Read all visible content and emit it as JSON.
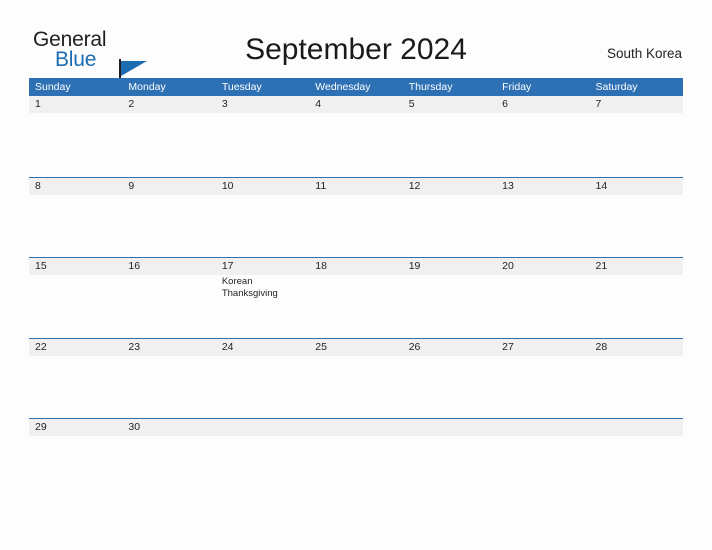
{
  "branding": {
    "logo_text_top": "General",
    "logo_text_bottom": "Blue",
    "logo_color_dark": "#231f20",
    "logo_color_blue": "#1b6cb0"
  },
  "header": {
    "title": "September 2024",
    "region": "South Korea"
  },
  "colors": {
    "header_blue": "#2d71b4",
    "band_gray": "#f0f0f0",
    "row_rule_blue": "#2d71b4",
    "page_background": "#fdfdfd",
    "text": "#231f20"
  },
  "calendar": {
    "month": "September",
    "year": "2024",
    "day_names": [
      "Sunday",
      "Monday",
      "Tuesday",
      "Wednesday",
      "Thursday",
      "Friday",
      "Saturday"
    ],
    "weeks": [
      [
        {
          "date": "1",
          "events": []
        },
        {
          "date": "2",
          "events": []
        },
        {
          "date": "3",
          "events": []
        },
        {
          "date": "4",
          "events": []
        },
        {
          "date": "5",
          "events": []
        },
        {
          "date": "6",
          "events": []
        },
        {
          "date": "7",
          "events": []
        }
      ],
      [
        {
          "date": "8",
          "events": []
        },
        {
          "date": "9",
          "events": []
        },
        {
          "date": "10",
          "events": []
        },
        {
          "date": "11",
          "events": []
        },
        {
          "date": "12",
          "events": []
        },
        {
          "date": "13",
          "events": []
        },
        {
          "date": "14",
          "events": []
        }
      ],
      [
        {
          "date": "15",
          "events": []
        },
        {
          "date": "16",
          "events": []
        },
        {
          "date": "17",
          "events": [
            "Korean Thanksgiving"
          ]
        },
        {
          "date": "18",
          "events": []
        },
        {
          "date": "19",
          "events": []
        },
        {
          "date": "20",
          "events": []
        },
        {
          "date": "21",
          "events": []
        }
      ],
      [
        {
          "date": "22",
          "events": []
        },
        {
          "date": "23",
          "events": []
        },
        {
          "date": "24",
          "events": []
        },
        {
          "date": "25",
          "events": []
        },
        {
          "date": "26",
          "events": []
        },
        {
          "date": "27",
          "events": []
        },
        {
          "date": "28",
          "events": []
        }
      ],
      [
        {
          "date": "29",
          "events": []
        },
        {
          "date": "30",
          "events": []
        },
        {
          "date": "",
          "events": []
        },
        {
          "date": "",
          "events": []
        },
        {
          "date": "",
          "events": []
        },
        {
          "date": "",
          "events": []
        },
        {
          "date": "",
          "events": []
        }
      ]
    ]
  }
}
